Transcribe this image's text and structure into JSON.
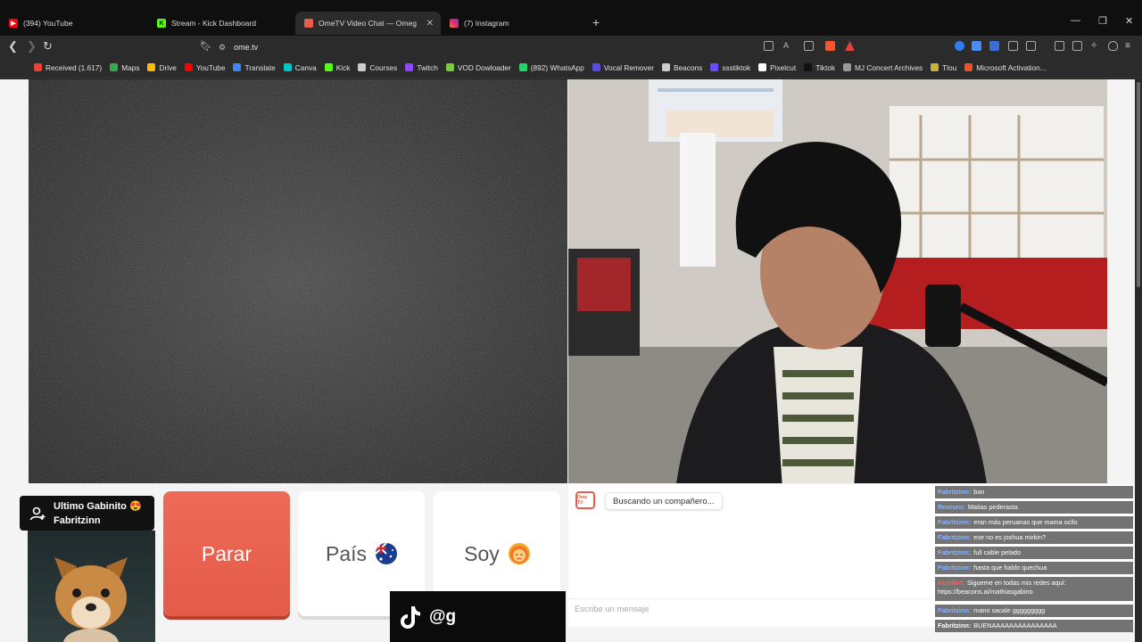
{
  "browser": {
    "tabs": [
      {
        "title": "(394) YouTube",
        "icon": "youtube-icon",
        "color": "#ff0000"
      },
      {
        "title": "Stream - Kick Dashboard",
        "icon": "kick-icon",
        "color": "#53fc18"
      },
      {
        "title": "OmeTV Video Chat — Omegl",
        "icon": "ometv-icon",
        "color": "#e85d4a",
        "active": true
      },
      {
        "title": "(7) Instagram",
        "icon": "instagram-icon",
        "color": "#e1306c"
      }
    ],
    "new_tab": "+",
    "url": "ome.tv",
    "bookmarks": [
      {
        "label": "Received (1.617)",
        "icon": "gmail-icon",
        "color": "#ea4335"
      },
      {
        "label": "Maps",
        "icon": "maps-icon",
        "color": "#34a853"
      },
      {
        "label": "Drive",
        "icon": "drive-icon",
        "color": "#fbbc04"
      },
      {
        "label": "YouTube",
        "icon": "youtube-icon",
        "color": "#ff0000"
      },
      {
        "label": "Translate",
        "icon": "translate-icon",
        "color": "#4285f4"
      },
      {
        "label": "Canva",
        "icon": "canva-icon",
        "color": "#00c4cc"
      },
      {
        "label": "Kick",
        "icon": "kick-icon",
        "color": "#53fc18"
      },
      {
        "label": "Courses",
        "icon": "courses-icon",
        "color": "#cccccc"
      },
      {
        "label": "Twitch",
        "icon": "twitch-icon",
        "color": "#9146ff"
      },
      {
        "label": "VOD Dowloader",
        "icon": "vod-icon",
        "color": "#7ac943"
      },
      {
        "label": "(892) WhatsApp",
        "icon": "whatsapp-icon",
        "color": "#25d366"
      },
      {
        "label": "Vocal Remover",
        "icon": "vocal-remover-icon",
        "color": "#5b4bdb"
      },
      {
        "label": "Beacons",
        "icon": "beacons-icon",
        "color": "#cccccc"
      },
      {
        "label": "ssstiktok",
        "icon": "ssstiktok-icon",
        "color": "#6c4bff"
      },
      {
        "label": "Pixelcut",
        "icon": "pixelcut-icon",
        "color": "#ffffff"
      },
      {
        "label": "Tiktok",
        "icon": "tiktok-icon",
        "color": "#111111"
      },
      {
        "label": "MJ Concert Archives",
        "icon": "mj-icon",
        "color": "#999999"
      },
      {
        "label": "Tlou",
        "icon": "tlou-icon",
        "color": "#c9b23c"
      },
      {
        "label": "Microsoft Activation...",
        "icon": "microsoft-icon",
        "color": "#f25022"
      }
    ]
  },
  "controls": {
    "stop_label": "Parar",
    "country_label": "País",
    "gender_label": "Soy"
  },
  "chat": {
    "status": "Buscando un compañero...",
    "input_placeholder": "Escribe un mensaje",
    "logo_text": "Ome TV"
  },
  "overlay": {
    "tag_line1": "Ultimo Gabinito 😍",
    "tag_line2": "Fabritzinn",
    "tiktok_handle": "@g"
  },
  "stream_chat": [
    {
      "user": "Fabritzinn:",
      "text": "ban",
      "style": "blue"
    },
    {
      "user": "Reoruru:",
      "text": "Matias pederasta",
      "style": "blue"
    },
    {
      "user": "Fabritzinn:",
      "text": "eran más peruanas que mama ocllo",
      "style": "blue"
    },
    {
      "user": "Fabritzinn:",
      "text": "ese no es joshua mirkin?",
      "style": "blue"
    },
    {
      "user": "Fabritzinn:",
      "text": "full cable pelado",
      "style": "blue"
    },
    {
      "user": "Fabritzinn:",
      "text": "hasta que hablo quechua",
      "style": "blue"
    },
    {
      "user": "KickBot:",
      "text": "Sigueme en todas mis redes aquí: https://beacons.ai/mathiasgabino",
      "style": "kick"
    },
    {
      "user": "Fabritzinn:",
      "text": "mano sacale ggggggggg",
      "style": "blue"
    },
    {
      "user": "Fabritzinn:",
      "text": "BUENAAAAAAAAAAAAAAA",
      "style": "white"
    }
  ],
  "colors": {
    "accent": "#e85d4a",
    "page_bg": "#f4f4f4",
    "browser_bg": "#2b2b2b"
  }
}
